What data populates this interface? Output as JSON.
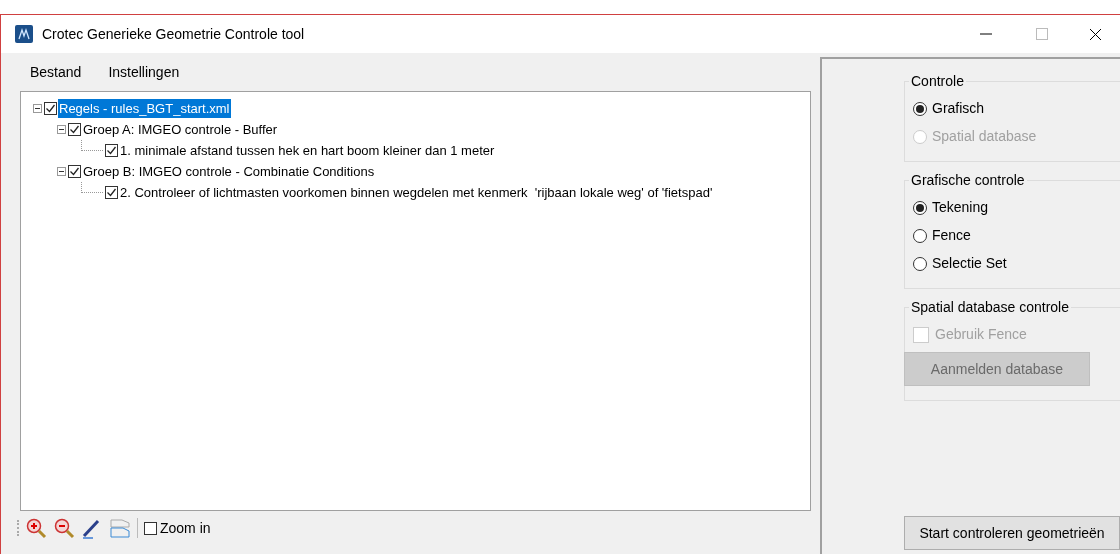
{
  "window": {
    "title": "Crotec Generieke Geometrie Controle tool"
  },
  "menu": [
    "Bestand",
    "Instellingen"
  ],
  "tree": [
    {
      "label": "Regels - rules_BGT_start.xml",
      "checked": true,
      "selected": true,
      "expanded": true,
      "children": [
        {
          "label": "Groep A: IMGEO controle - Buffer",
          "checked": true,
          "selected": false,
          "expanded": true,
          "children": [
            {
              "label": "1. minimale afstand tussen hek en hart boom kleiner dan 1 meter",
              "checked": true,
              "selected": false
            }
          ]
        },
        {
          "label": "Groep B: IMGEO controle - Combinatie Conditions",
          "checked": true,
          "selected": false,
          "expanded": true,
          "children": [
            {
              "label": "2. Controleer of lichtmasten voorkomen binnen wegdelen met kenmerk  'rijbaan lokale weg' of 'fietspad'",
              "checked": true,
              "selected": false
            }
          ]
        }
      ]
    }
  ],
  "toolbar": {
    "zoom_checkbox": {
      "label": "Zoom in",
      "checked": false
    }
  },
  "groups": [
    {
      "title": "Controle",
      "items": [
        {
          "kind": "radio",
          "label": "Grafisch",
          "selected": true,
          "disabled": false
        },
        {
          "kind": "radio",
          "label": "Spatial database",
          "selected": false,
          "disabled": true
        }
      ]
    },
    {
      "title": "Grafische controle",
      "items": [
        {
          "kind": "radio",
          "label": "Tekening",
          "selected": true,
          "disabled": false
        },
        {
          "kind": "radio",
          "label": "Fence",
          "selected": false,
          "disabled": false
        },
        {
          "kind": "radio",
          "label": "Selectie Set",
          "selected": false,
          "disabled": false
        }
      ]
    },
    {
      "title": "Spatial database controle",
      "items": [
        {
          "kind": "checkbox",
          "label": "Gebruik Fence",
          "checked": false,
          "disabled": true
        },
        {
          "kind": "button",
          "label": "Aanmelden database",
          "disabled": true
        }
      ]
    }
  ],
  "start_button": "Start controleren geometrieën"
}
